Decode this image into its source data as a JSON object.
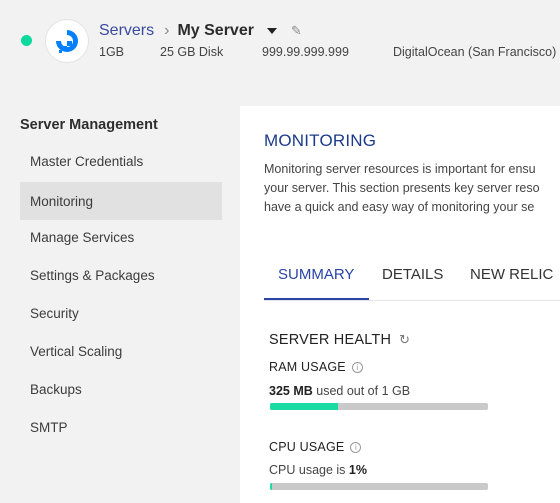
{
  "header": {
    "breadcrumb_root": "Servers",
    "breadcrumb_separator": "›",
    "server_name": "My Server",
    "ram": "1GB",
    "disk": "25 GB Disk",
    "ip": "999.99.999.999",
    "provider": "DigitalOcean (San Francisco)",
    "status_color": "#0bd99e",
    "provider_logo_icon": "digitalocean-logo-icon",
    "edit_icon": "pencil-icon"
  },
  "sidebar": {
    "title": "Server Management",
    "items": [
      {
        "label": "Master Credentials"
      },
      {
        "label": "Monitoring"
      },
      {
        "label": "Manage Services"
      },
      {
        "label": "Settings & Packages"
      },
      {
        "label": "Security"
      },
      {
        "label": "Vertical Scaling"
      },
      {
        "label": "Backups"
      },
      {
        "label": "SMTP"
      }
    ],
    "active_item": "Monitoring"
  },
  "main": {
    "title": "MONITORING",
    "description_lines": [
      "Monitoring server resources is important for ensu",
      "your server. This section presents key server reso",
      "have a quick and easy way of monitoring your se"
    ],
    "tabs": [
      {
        "label": "SUMMARY"
      },
      {
        "label": "DETAILS"
      },
      {
        "label": "NEW RELIC"
      }
    ],
    "active_tab": "SUMMARY",
    "server_health": {
      "title": "SERVER HEALTH",
      "ram": {
        "label": "RAM USAGE",
        "value": "325 MB",
        "suffix": " used out of 1 GB",
        "fraction": 0.31
      },
      "cpu": {
        "label": "CPU USAGE",
        "prefix": "CPU usage is ",
        "value": "1%",
        "fraction": 0.01
      }
    },
    "accent_color": "#2a44a8",
    "bar_color": "#19dba3"
  }
}
